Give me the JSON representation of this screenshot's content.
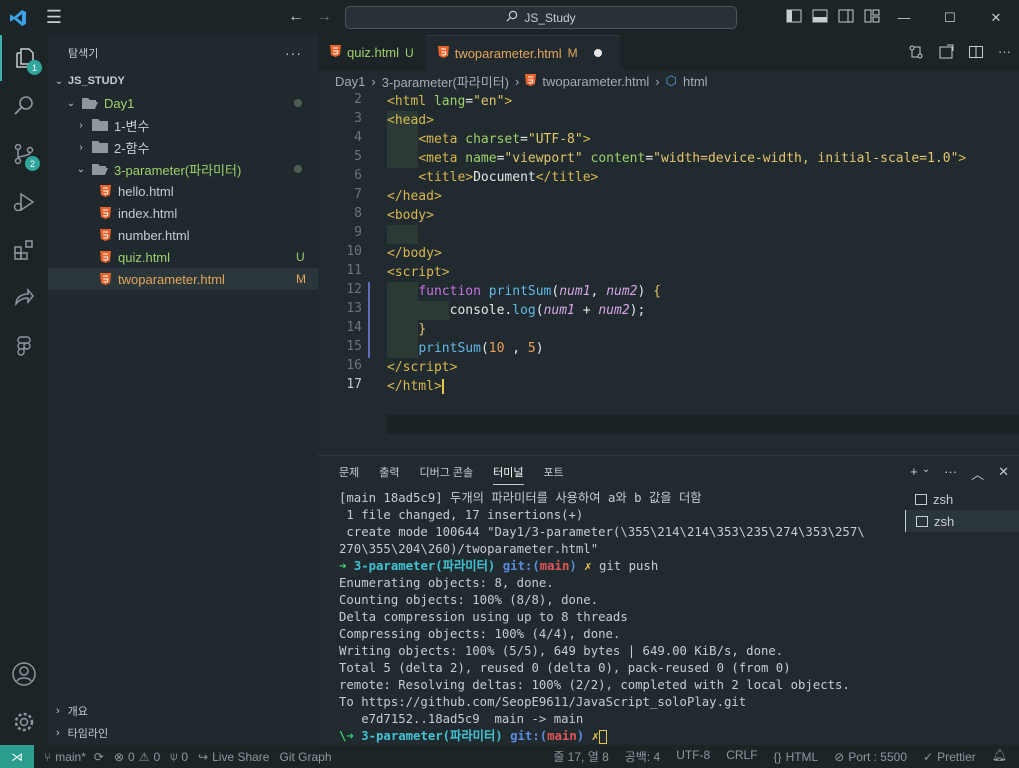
{
  "titlebar": {
    "search_text": "JS_Study"
  },
  "activity": {
    "explorer_badge": "1",
    "scm_badge": "2"
  },
  "sidebar": {
    "header": "탐색기",
    "root": "JS_STUDY",
    "items": [
      {
        "label": "Day1"
      },
      {
        "label": "1-변수"
      },
      {
        "label": "2-함수"
      },
      {
        "label": "3-parameter(파라미터)"
      },
      {
        "label": "hello.html"
      },
      {
        "label": "index.html"
      },
      {
        "label": "number.html"
      },
      {
        "label": "quiz.html",
        "status": "U"
      },
      {
        "label": "twoparameter.html",
        "status": "M"
      }
    ],
    "outline": "개요",
    "timeline": "타임라인"
  },
  "tabs": [
    {
      "label": "quiz.html",
      "status": "U"
    },
    {
      "label": "twoparameter.html",
      "status": "M"
    }
  ],
  "breadcrumb": {
    "part1": "Day1",
    "part2": "3-parameter(파라미터)",
    "part3": "twoparameter.html",
    "part4": "html"
  },
  "editor": {
    "line_numbers": [
      "2",
      "3",
      "4",
      "5",
      "6",
      "7",
      "8",
      "9",
      "10",
      "11",
      "12",
      "13",
      "14",
      "15",
      "16",
      "17"
    ]
  },
  "panel": {
    "tabs": [
      "문제",
      "출력",
      "디버그 콘솔",
      "터미널",
      "포트"
    ],
    "terminals": [
      "zsh",
      "zsh"
    ]
  },
  "status": {
    "branch": "main*",
    "errors": "0",
    "warnings": "0",
    "ports_count": "0",
    "live_share": "Live Share",
    "git_graph": "Git Graph",
    "position": "줄 17, 열 8",
    "spaces": "공백: 4",
    "encoding": "UTF-8",
    "eol": "CRLF",
    "language": "HTML",
    "port": "Port : 5500",
    "prettier": "Prettier"
  }
}
